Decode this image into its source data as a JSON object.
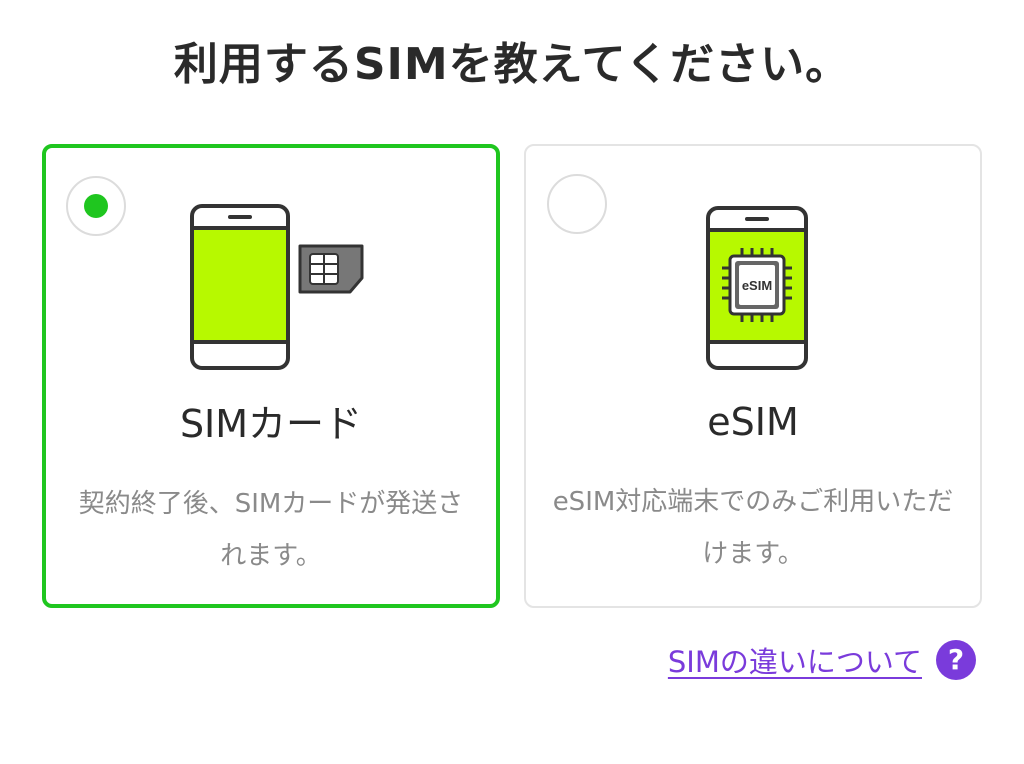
{
  "page": {
    "title": "利用するSIMを教えてください。"
  },
  "options": [
    {
      "title": "SIMカード",
      "description": "契約終了後、SIMカードが発送されます。",
      "selected": true,
      "icon": "phone-with-sim-card-icon"
    },
    {
      "title": "eSIM",
      "description": "eSIM対応端末でのみご利用いただけます。",
      "selected": false,
      "icon": "phone-with-esim-chip-icon",
      "chip_label": "eSIM"
    }
  ],
  "help": {
    "link_text": "SIMの違いについて",
    "icon_text": "?",
    "icon": "question-circle-icon"
  },
  "colors": {
    "accent_green": "#1fc61f",
    "screen_lime": "#b7f900",
    "link_purple": "#7a3bdb",
    "muted_text": "#8a8a8a",
    "border_gray": "#e4e4e4"
  }
}
